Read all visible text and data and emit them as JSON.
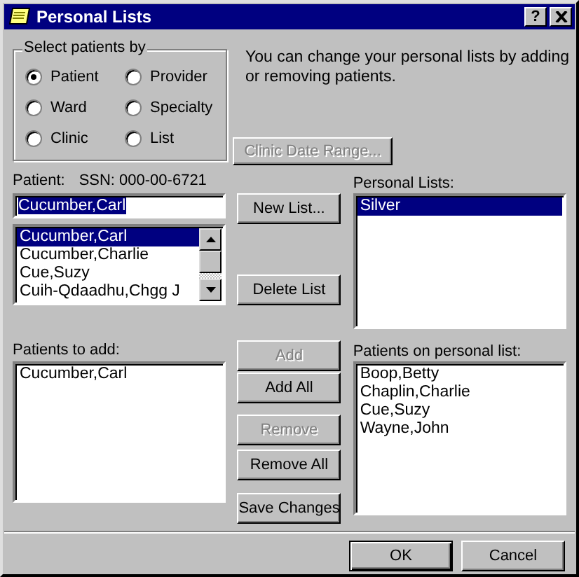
{
  "window": {
    "title": "Personal Lists",
    "help_button": "?"
  },
  "select_by": {
    "label": "Select patients by",
    "options": [
      {
        "label": "Patient",
        "selected": true
      },
      {
        "label": "Provider",
        "selected": false
      },
      {
        "label": "Ward",
        "selected": false
      },
      {
        "label": "Specialty",
        "selected": false
      },
      {
        "label": "Clinic",
        "selected": false
      },
      {
        "label": "List",
        "selected": false
      }
    ]
  },
  "info_text": "You can change your personal lists by adding or removing patients.",
  "clinic_date_range_button": {
    "label": "Clinic Date Range...",
    "disabled": true
  },
  "patient": {
    "label": "Patient:",
    "ssn": "SSN: 000-00-6721",
    "value": "Cucumber,Carl",
    "items": [
      {
        "name": "Cucumber,Carl",
        "selected": true
      },
      {
        "name": "Cucumber,Charlie",
        "selected": false
      },
      {
        "name": "Cue,Suzy",
        "selected": false
      },
      {
        "name": "Cuih-Qdaadhu,Chgg J",
        "selected": false
      }
    ]
  },
  "list_buttons": [
    {
      "label": "New List...",
      "disabled": false
    },
    {
      "label": "Delete List",
      "disabled": false
    }
  ],
  "personal_lists": {
    "label": "Personal Lists:",
    "items": [
      {
        "name": "Silver",
        "selected": true
      }
    ]
  },
  "patients_to_add": {
    "label": "Patients to add:",
    "items": [
      {
        "name": "Cucumber,Carl",
        "selected": false
      }
    ]
  },
  "transfer_buttons": [
    {
      "label": "Add",
      "disabled": true
    },
    {
      "label": "Add All",
      "disabled": false
    },
    {
      "label": "Remove",
      "disabled": true
    },
    {
      "label": "Remove All",
      "disabled": false
    },
    {
      "label": "Save Changes",
      "disabled": false
    }
  ],
  "patients_on_list": {
    "label": "Patients on personal list:",
    "items": [
      {
        "name": "Boop,Betty",
        "selected": false
      },
      {
        "name": "Chaplin,Charlie",
        "selected": false
      },
      {
        "name": "Cue,Suzy",
        "selected": false
      },
      {
        "name": "Wayne,John",
        "selected": false
      }
    ]
  },
  "footer_buttons": [
    {
      "label": "OK",
      "default": true
    },
    {
      "label": "Cancel",
      "default": false
    }
  ]
}
